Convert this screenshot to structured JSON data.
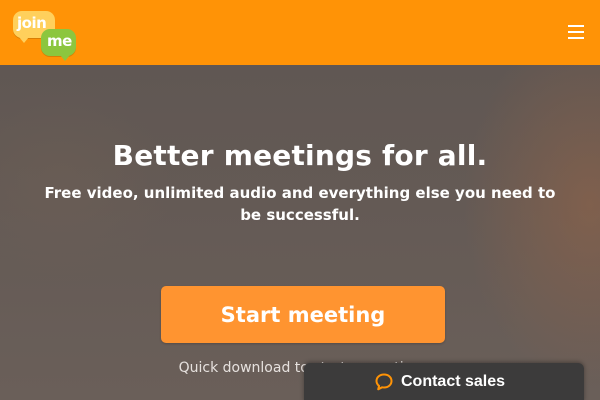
{
  "header": {
    "logo": {
      "word_top": "join",
      "word_bottom": "me",
      "colors": {
        "join_bubble": "#ffd05c",
        "me_bubble": "#8cc63e"
      }
    },
    "menu_icon": "hamburger-menu-icon",
    "background_color": "#ff9306"
  },
  "hero": {
    "title": "Better meetings for all.",
    "subtitle": "Free video, unlimited audio and everything else you need to be successful.",
    "start_button_label": "Start meeting",
    "download_link": "Quick download to start a meeting",
    "button_color": "#ff9430"
  },
  "contact": {
    "label": "Contact sales",
    "icon": "chat-bubble-icon",
    "icon_color": "#ff9306",
    "background_color": "#3c3b3b"
  }
}
